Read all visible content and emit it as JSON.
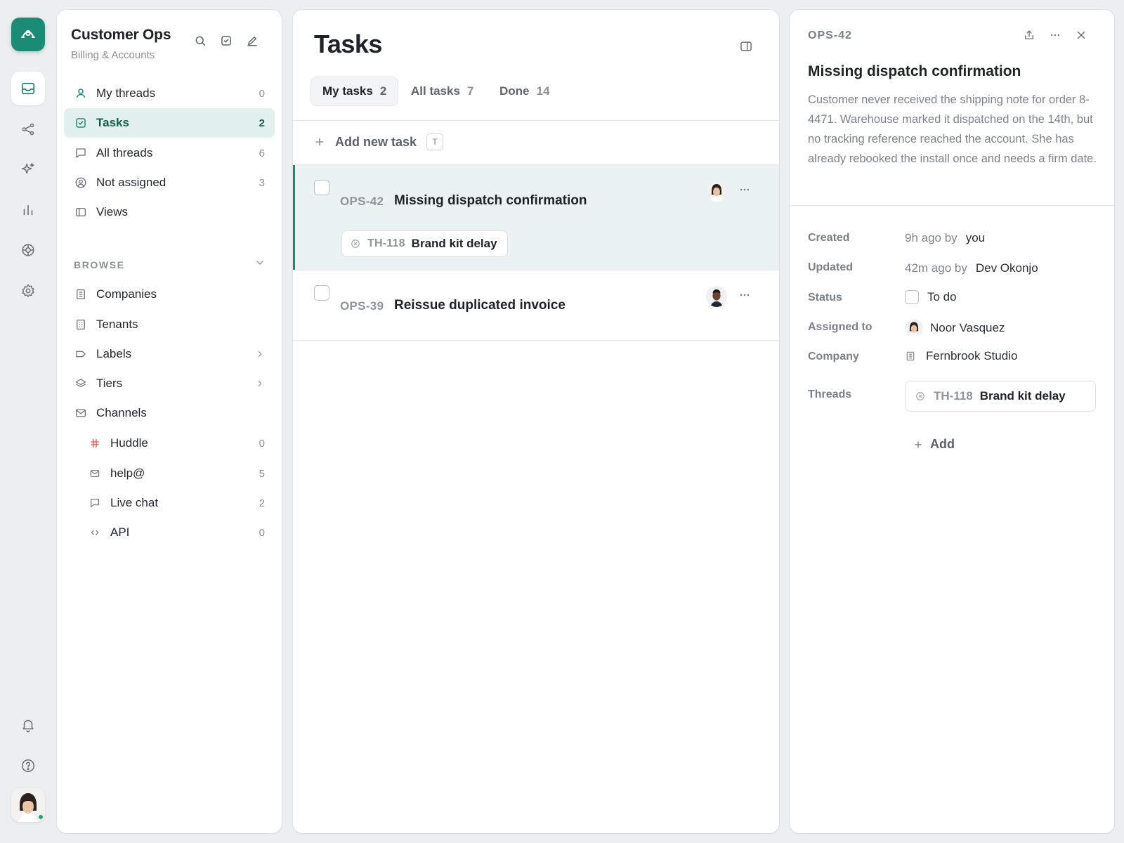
{
  "colors": {
    "accent": "#1c8b75",
    "accent_bg": "#e2f1ed",
    "selected_row": "#eaf3f1",
    "background": "#eceef0"
  },
  "rail": {
    "logo_icon": "chat-logo-icon",
    "items": [
      {
        "name": "inbox-icon",
        "active": true
      },
      {
        "name": "workflows-icon",
        "active": false
      },
      {
        "name": "ai-sparkle-icon",
        "active": false
      },
      {
        "name": "reports-icon",
        "active": false
      },
      {
        "name": "help-center-icon",
        "active": false
      },
      {
        "name": "settings-icon",
        "active": false
      }
    ],
    "bottom": [
      "bell-icon",
      "help-icon"
    ]
  },
  "workspace": {
    "name": "Customer Ops",
    "subtitle": "Billing & Accounts"
  },
  "nav": {
    "items": [
      {
        "label": "My threads",
        "count": "0"
      },
      {
        "label": "Tasks",
        "count": "2",
        "active": true
      },
      {
        "label": "All threads",
        "count": "6"
      },
      {
        "label": "Not assigned",
        "count": "3"
      },
      {
        "label": "Views"
      }
    ],
    "browse_label": "BROWSE",
    "browse_items": [
      {
        "label": "Companies"
      },
      {
        "label": "Tenants"
      },
      {
        "label": "Labels",
        "has_submenu": true
      },
      {
        "label": "Tiers",
        "has_submenu": true
      },
      {
        "label": "Channels"
      }
    ],
    "channels": [
      {
        "label": "Huddle",
        "count": "0"
      },
      {
        "label": "help@",
        "count": "5"
      },
      {
        "label": "Live chat",
        "count": "2"
      },
      {
        "label": "API",
        "count": "0"
      }
    ]
  },
  "tasks": {
    "title": "Tasks",
    "tabs": [
      {
        "label": "My tasks",
        "count": "2",
        "active": true
      },
      {
        "label": "All tasks",
        "count": "7"
      },
      {
        "label": "Done",
        "count": "14"
      }
    ],
    "add_label": "Add new task",
    "add_shortcut": "T",
    "rows": [
      {
        "id": "OPS-42",
        "title": "Missing dispatch confirmation",
        "selected": true,
        "thread": {
          "id": "TH-118",
          "title": "Brand kit delay"
        }
      },
      {
        "id": "OPS-39",
        "title": "Reissue duplicated invoice",
        "selected": false
      }
    ]
  },
  "detail": {
    "id": "OPS-42",
    "title": "Missing dispatch confirmation",
    "description": "Customer never received the shipping note for order 8-4471. Warehouse marked it dispatched on the 14th, but no tracking reference reached the account. She has already rebooked the install once and needs a firm date.",
    "props": {
      "created_label": "Created",
      "created_time": "9h ago by",
      "created_by": "you",
      "updated_label": "Updated",
      "updated_time": "42m ago by",
      "updated_by": "Dev Okonjo",
      "status_label": "Status",
      "status_value": "To do",
      "assigned_label": "Assigned to",
      "assigned_value": "Noor Vasquez",
      "company_label": "Company",
      "company_value": "Fernbrook Studio",
      "threads_label": "Threads",
      "thread_id": "TH-118",
      "thread_title": "Brand kit delay",
      "add_label": "Add"
    }
  }
}
